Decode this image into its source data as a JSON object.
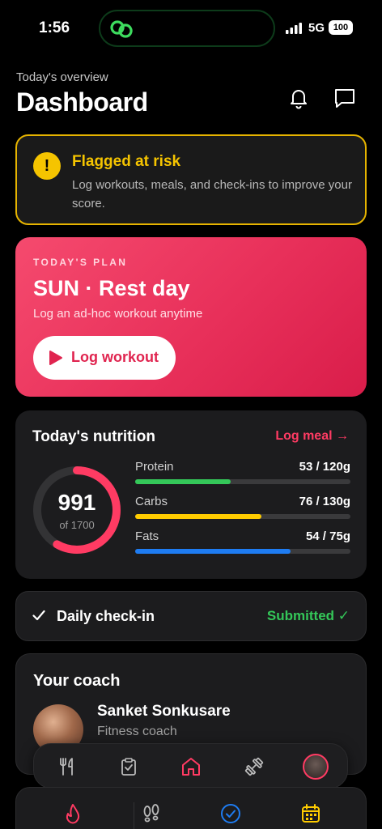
{
  "status_bar": {
    "time": "1:56",
    "network": "5G",
    "battery": "100"
  },
  "header": {
    "subtitle": "Today's overview",
    "title": "Dashboard"
  },
  "alert": {
    "title": "Flagged at risk",
    "message": "Log workouts, meals, and check-ins to improve your score.",
    "badge": "!"
  },
  "plan": {
    "kicker": "TODAY'S PLAN",
    "title": "SUN · Rest day",
    "subtitle": "Log an ad-hoc workout anytime",
    "button_label": "Log workout"
  },
  "nutrition": {
    "title": "Today's nutrition",
    "link_label": "Log meal →",
    "calories": "991",
    "calories_target": "of 1700",
    "calories_fraction": 0.583,
    "macros": [
      {
        "name": "Protein",
        "value": "53 / 120g",
        "fraction": 0.442,
        "color": "#34c759"
      },
      {
        "name": "Carbs",
        "value": "76 / 130g",
        "fraction": 0.585,
        "color": "#ffcc00"
      },
      {
        "name": "Fats",
        "value": "54 / 75g",
        "fraction": 0.72,
        "color": "#1e7cf2"
      }
    ]
  },
  "checkin": {
    "label": "Daily check-in",
    "status": "Submitted ✓"
  },
  "coach": {
    "title": "Your coach",
    "name": "Sanket Sonkusare",
    "role": "Fitness coach"
  },
  "tabbar": {
    "items": [
      "utensils-icon",
      "clipboard-icon",
      "home-icon",
      "dumbbell-icon",
      "profile-avatar"
    ],
    "active": "home-icon"
  },
  "bottom_panel": {
    "items": [
      "flame-icon",
      "footsteps-icon",
      "check-circle-icon",
      "calendar-icon"
    ]
  },
  "colors": {
    "accent": "#ff3b63",
    "warning": "#f5c400",
    "success": "#34c759",
    "info": "#1e7cf2"
  }
}
